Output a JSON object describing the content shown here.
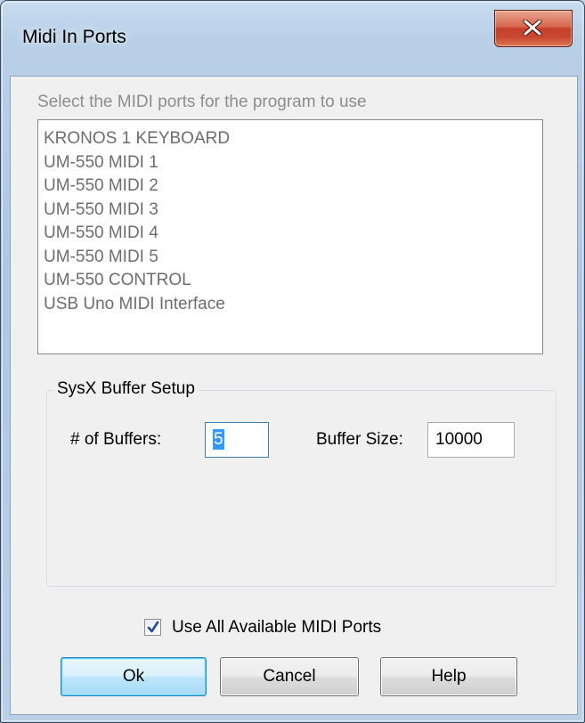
{
  "window": {
    "title": "Midi In Ports",
    "close_icon": "close-x-icon"
  },
  "prompt": "Select the MIDI ports for the program to use",
  "ports": [
    "KRONOS 1 KEYBOARD",
    "UM-550 MIDI 1",
    "UM-550 MIDI 2",
    "UM-550 MIDI 3",
    "UM-550 MIDI 4",
    "UM-550 MIDI 5",
    "UM-550 CONTROL",
    "USB Uno MIDI Interface"
  ],
  "sysx": {
    "group_title": "SysX Buffer Setup",
    "num_buffers_label": "# of Buffers:",
    "num_buffers_value": "5",
    "buffer_size_label": "Buffer Size:",
    "buffer_size_value": "10000"
  },
  "use_all": {
    "label": "Use All Available MIDI Ports",
    "checked": true
  },
  "buttons": {
    "ok": "Ok",
    "cancel": "Cancel",
    "help": "Help"
  },
  "colors": {
    "accent": "#3c7fb1",
    "close_button": "#c5412a",
    "disabled_text": "#8d8d8d"
  }
}
